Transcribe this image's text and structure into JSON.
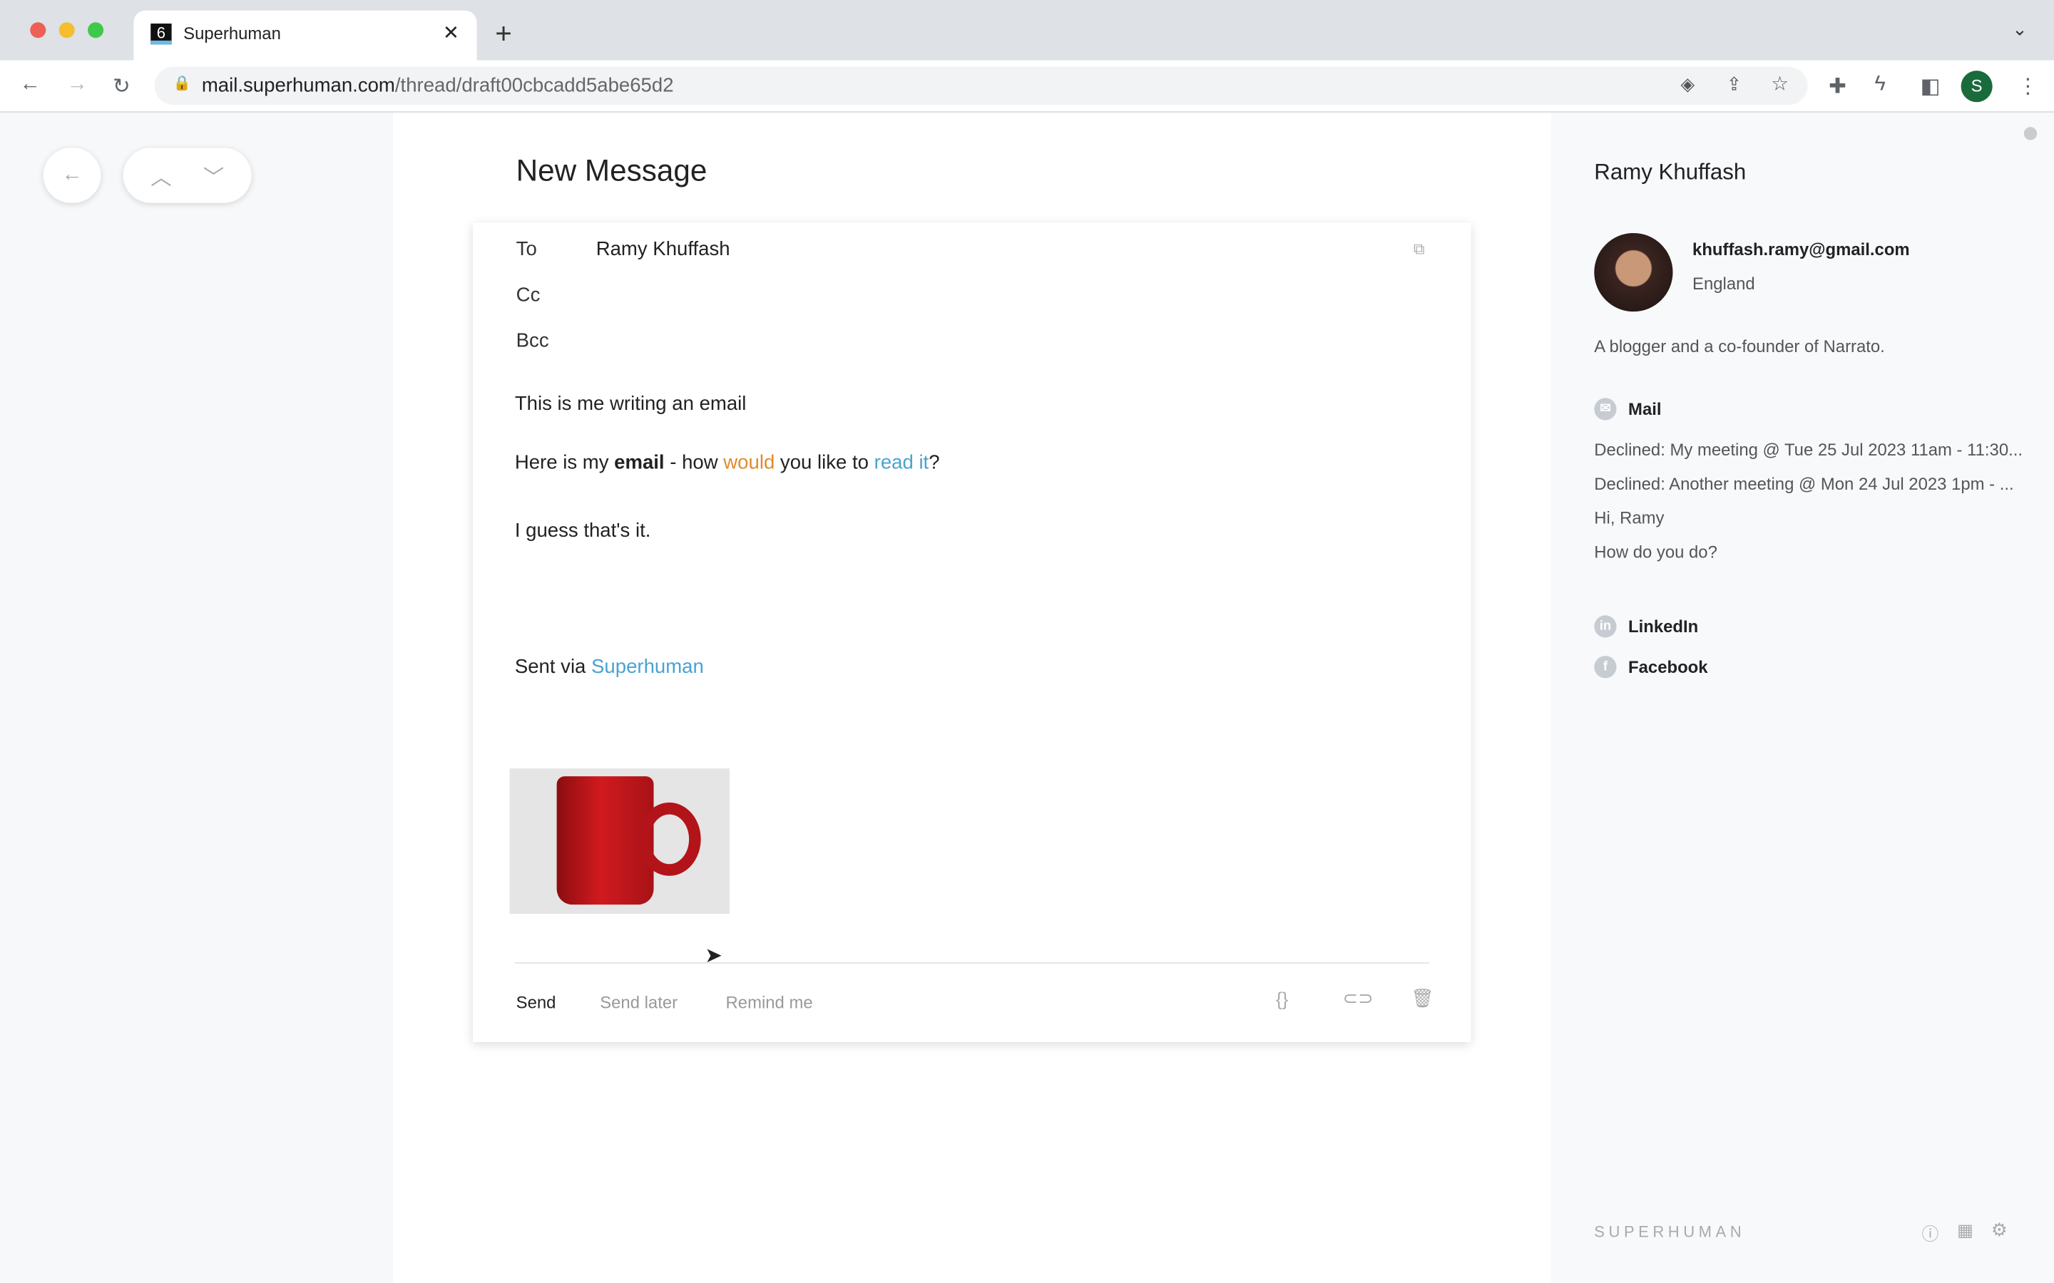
{
  "browser": {
    "tab_title": "Superhuman",
    "tab_favicon": "6",
    "url_host": "mail.superhuman.com",
    "url_path": "/thread/draft00cbcadd5abe65d2",
    "profile_initial": "S"
  },
  "compose": {
    "heading": "New Message",
    "to_label": "To",
    "to_value": "Ramy Khuffash",
    "cc_label": "Cc",
    "bcc_label": "Bcc",
    "body": {
      "line1": "This is me writing an email",
      "line2_a": "Here is my ",
      "line2_bold": "email",
      "line2_b": " - how ",
      "line2_orange": "would",
      "line2_c": " you like to ",
      "line2_link": "read it",
      "line2_d": "?",
      "line3": "I guess that's it.",
      "sig_prefix": "Sent via ",
      "sig_link": "Superhuman"
    },
    "send": "Send",
    "send_later": "Send later",
    "remind_me": "Remind me"
  },
  "contact": {
    "name": "Ramy Khuffash",
    "email": "khuffash.ramy@gmail.com",
    "location": "England",
    "bio": "A blogger and a co-founder of Narrato.",
    "mail_label": "Mail",
    "mails": [
      "Declined: My meeting @ Tue 25 Jul 2023 11am - 11:30...",
      "Declined: Another meeting @ Mon 24 Jul 2023 1pm - ...",
      "Hi, Ramy",
      "How do you do?"
    ],
    "linkedin": "LinkedIn",
    "facebook": "Facebook"
  },
  "footer": {
    "brand": "SUPERHUMAN"
  },
  "colors": {
    "link": "#4aa3d0",
    "highlight": "#e08a2e"
  }
}
